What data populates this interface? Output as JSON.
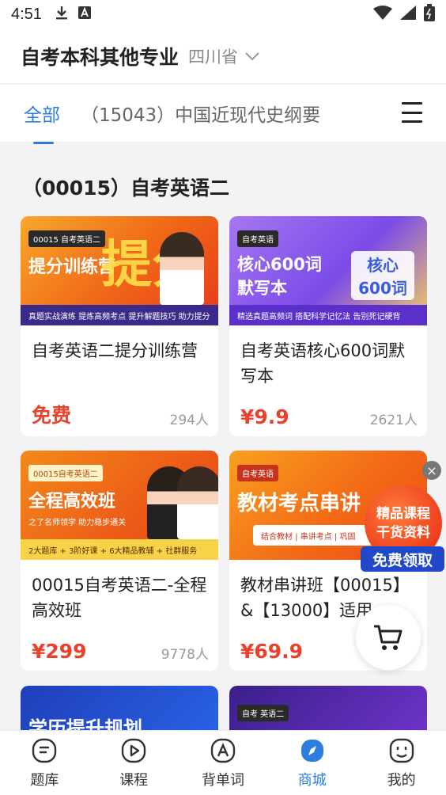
{
  "status_bar": {
    "time": "4:51"
  },
  "header": {
    "title": "自考本科其他专业",
    "region": "四川省"
  },
  "tabs": [
    {
      "label": "全部",
      "active": true
    },
    {
      "label": "（15043）中国近现代史纲要",
      "active": false
    }
  ],
  "section": {
    "title": "（00015）自考英语二"
  },
  "cards": [
    {
      "title": "自考英语二提分训练营",
      "price": "免费",
      "count": "294人",
      "banner": {
        "tag": "00015 自考英语二",
        "headline": "提分训练营",
        "big": "提分",
        "strip": "真题实战演练 提炼高频考点  提升解题技巧 助力提分"
      }
    },
    {
      "title": "自考英语核心600词默写本",
      "price": "¥9.9",
      "count": "2621人",
      "banner": {
        "tag": "自考英语",
        "headline": "核心600词 默写本",
        "big": "核心600词",
        "strip": "精选真题高频词  搭配科学记忆法  告别死记硬背"
      }
    },
    {
      "title": "00015自考英语二-全程高效班",
      "price": "¥299",
      "count": "9778人",
      "banner": {
        "tag": "00015自考英语二",
        "headline": "全程高效班",
        "sub": "之了名师领学 助力稳步通关",
        "strip": "2大题库 + 3阶好课 + 6大精品教辅 + 社群服务"
      }
    },
    {
      "title": "教材串讲班【00015】&【13000】适用",
      "price": "¥69.9",
      "count": "",
      "banner": {
        "tag": "自考英语",
        "headline": "教材考点串讲",
        "strip": "结合教材 | 串讲考点 | 巩固"
      }
    },
    {
      "title": "",
      "price": "",
      "count": "",
      "banner": {
        "tag": "",
        "headline": "学历提升规划"
      }
    },
    {
      "title": "",
      "price": "",
      "count": "",
      "banner": {
        "tag": "自考  英语二",
        "headline": ""
      }
    }
  ],
  "floating_ad": {
    "line1": "精品课程",
    "line2": "干货资料",
    "button": "免费领取"
  },
  "bottom_nav": [
    {
      "label": "题库",
      "icon": "question-bank-icon",
      "active": false
    },
    {
      "label": "课程",
      "icon": "play-course-icon",
      "active": false
    },
    {
      "label": "背单词",
      "icon": "vocabulary-icon",
      "active": false
    },
    {
      "label": "商城",
      "icon": "compass-mall-icon",
      "active": true
    },
    {
      "label": "我的",
      "icon": "profile-icon",
      "active": false
    }
  ],
  "colors": {
    "accent": "#2d7de0",
    "price": "#e9412b"
  }
}
